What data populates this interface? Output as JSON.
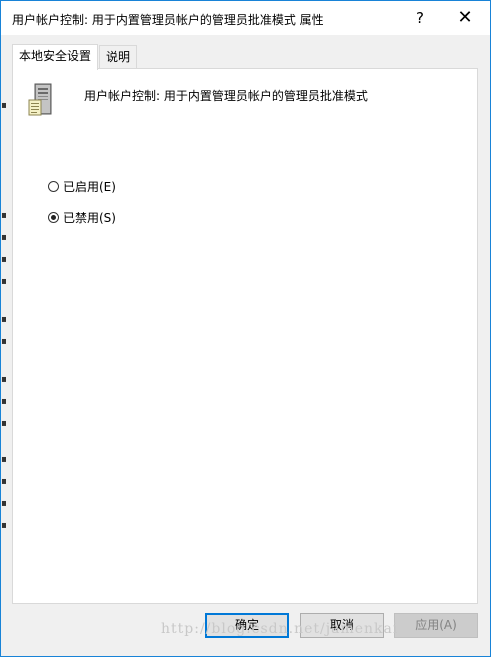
{
  "window": {
    "title": "用户帐户控制: 用于内置管理员帐户的管理员批准模式 属性",
    "help_glyph": "?",
    "close_glyph": "✕"
  },
  "tabs": [
    {
      "label": "本地安全设置",
      "active": true
    },
    {
      "label": "说明",
      "active": false
    }
  ],
  "policy": {
    "icon": "server-icon",
    "name": "用户帐户控制: 用于内置管理员帐户的管理员批准模式"
  },
  "options": [
    {
      "label": "已启用(E)",
      "checked": false
    },
    {
      "label": "已禁用(S)",
      "checked": true
    }
  ],
  "buttons": {
    "ok": "确定",
    "cancel": "取消",
    "apply": "应用(A)"
  },
  "watermark": "http://blog.csdn.net/jamenkai",
  "colors": {
    "accent": "#0078d7",
    "window_border": "#1883d7",
    "background": "#f0f0f0"
  }
}
